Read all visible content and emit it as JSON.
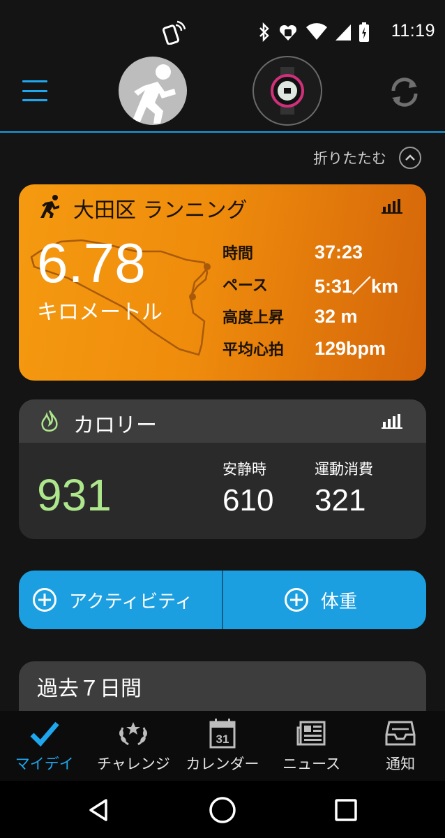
{
  "status_bar": {
    "time": "11:19"
  },
  "header": {
    "avatar_icon": "runner-icon",
    "device_icon": "watch-icon",
    "sync_icon": "sync-icon"
  },
  "collapse": {
    "label": "折りたたむ"
  },
  "run_card": {
    "title": "大田区 ランニング",
    "distance": "6.78",
    "unit": "キロメートル",
    "stats": [
      {
        "label": "時間",
        "value": "37:23"
      },
      {
        "label": "ペース",
        "value": "5:31／km"
      },
      {
        "label": "高度上昇",
        "value": "32 m"
      },
      {
        "label": "平均心拍",
        "value": "129bpm"
      }
    ],
    "accent": "#f59a10"
  },
  "calories": {
    "title": "カロリー",
    "total": "931",
    "resting_label": "安静時",
    "resting_value": "610",
    "active_label": "運動消費",
    "active_value": "321",
    "total_color": "#aee68c"
  },
  "actions": {
    "activity_label": "アクティビティ",
    "weight_label": "体重",
    "color": "#1b9fe0"
  },
  "past": {
    "title": "過去７日間"
  },
  "bottom_nav": {
    "items": [
      {
        "label": "マイデイ",
        "icon": "check-icon",
        "active": true
      },
      {
        "label": "チャレンジ",
        "icon": "laurel-icon",
        "active": false
      },
      {
        "label": "カレンダー",
        "icon": "calendar-icon",
        "active": false,
        "badge": "31"
      },
      {
        "label": "ニュース",
        "icon": "newspaper-icon",
        "active": false
      },
      {
        "label": "通知",
        "icon": "inbox-icon",
        "active": false
      }
    ]
  }
}
